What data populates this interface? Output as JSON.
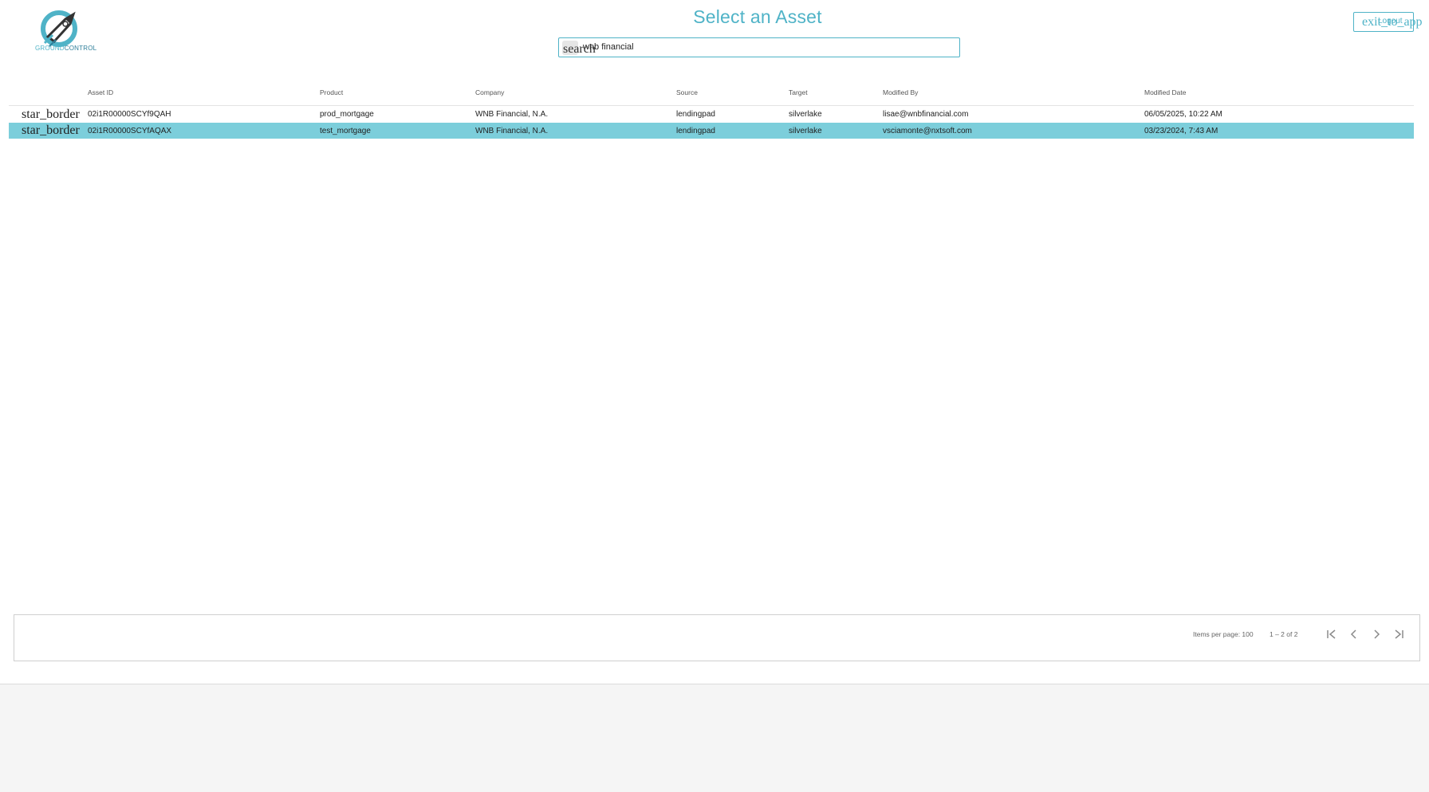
{
  "app": {
    "logo_text_1": "GROUND",
    "logo_text_2": "CONTROL",
    "title": "Select an Asset",
    "exit_label": "exit_to_app",
    "exit_label_small": "Logout"
  },
  "search": {
    "icon": "search",
    "value": "wnb financial"
  },
  "table": {
    "headers": [
      "",
      "Asset ID",
      "Product",
      "Company",
      "Source",
      "Target",
      "Modified By",
      "Modified Date"
    ],
    "rows": [
      {
        "star": "star_border",
        "asset_id": "02i1R00000SCYf9QAH",
        "product": "prod_mortgage",
        "company": "WNB Financial, N.A.",
        "source": "lendingpad",
        "target": "silverlake",
        "modified_by": "lisae@wnbfinancial.com",
        "modified_date": "06/05/2025, 10:22 AM"
      },
      {
        "star": "star_border",
        "asset_id": "02i1R00000SCYfAQAX",
        "product": "test_mortgage",
        "company": "WNB Financial, N.A.",
        "source": "lendingpad",
        "target": "silverlake",
        "modified_by": "vsciamonte@nxtsoft.com",
        "modified_date": "03/23/2024, 7:43 AM"
      }
    ]
  },
  "paginator": {
    "items_per_page": "Items per page: 100",
    "range": "1 – 2 of 2"
  },
  "colors": {
    "accent": "#4fb3c7",
    "selected_row": "#7ccedb"
  }
}
